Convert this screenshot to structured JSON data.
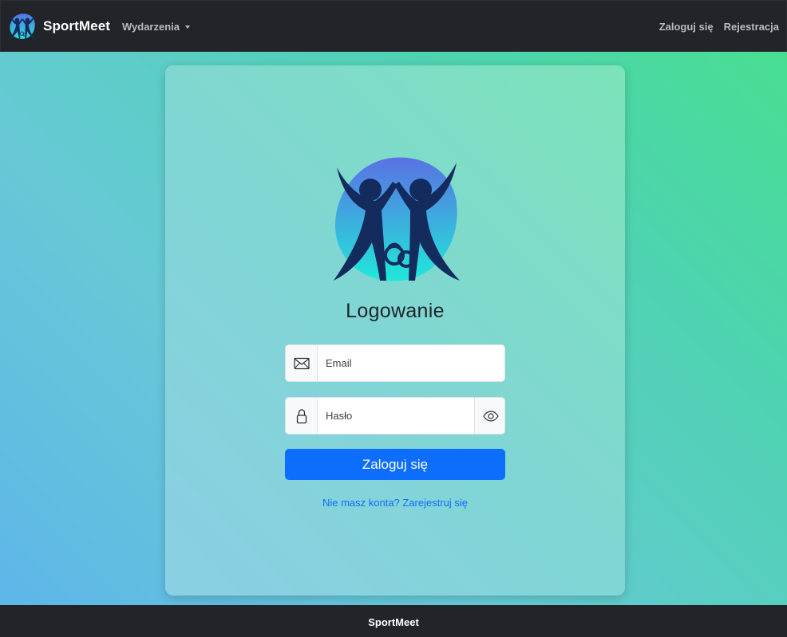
{
  "navbar": {
    "brand": "SportMeet",
    "dropdown_label": "Wydarzenia",
    "login_label": "Zaloguj się",
    "register_label": "Rejestracja"
  },
  "login": {
    "title": "Logowanie",
    "email_placeholder": "Email",
    "password_placeholder": "Hasło",
    "submit_label": "Zaloguj się",
    "register_link": "Nie masz konta? Zarejestruj się"
  },
  "footer": {
    "text": "SportMeet"
  },
  "icons": {
    "email": "envelope-icon",
    "password": "lock-icon",
    "toggle": "eye-icon",
    "brand": "sportmeet-logo"
  },
  "colors": {
    "navbar": "#212529",
    "primary": "#0d6efd",
    "logo_dark": "#142b5e",
    "logo_gradient_top": "#5a71e4",
    "logo_gradient_bottom": "#20e8da"
  }
}
